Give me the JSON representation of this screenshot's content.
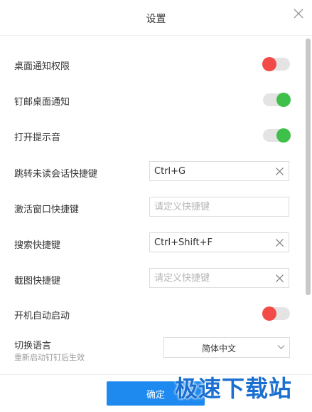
{
  "window": {
    "title": "设置"
  },
  "settings": {
    "desktop_notify_permission": {
      "label": "桌面通知权限",
      "enabled": false
    },
    "dingmail_notify": {
      "label": "钉邮桌面通知",
      "enabled": true
    },
    "sound": {
      "label": "打开提示音",
      "enabled": true
    },
    "jump_unread_shortcut": {
      "label": "跳转未读会话快捷键",
      "value": "Ctrl+G",
      "placeholder": ""
    },
    "activate_window_shortcut": {
      "label": "激活窗口快捷键",
      "value": "",
      "placeholder": "请定义快捷键"
    },
    "search_shortcut": {
      "label": "搜索快捷键",
      "value": "Ctrl+Shift+F",
      "placeholder": ""
    },
    "screenshot_shortcut": {
      "label": "截图快捷键",
      "value": "",
      "placeholder": "请定义快捷键"
    },
    "autostart": {
      "label": "开机自动启动",
      "enabled": false
    },
    "language": {
      "label": "切换语言",
      "note": "重新启动钉钉后生效",
      "selected": "简体中文"
    }
  },
  "footer": {
    "ok_label": "确定"
  },
  "watermark": {
    "text": "极速下载站"
  },
  "colors": {
    "toggle_on": "#3fc04a",
    "toggle_off": "#f24a46",
    "primary": "#1e8af0"
  }
}
